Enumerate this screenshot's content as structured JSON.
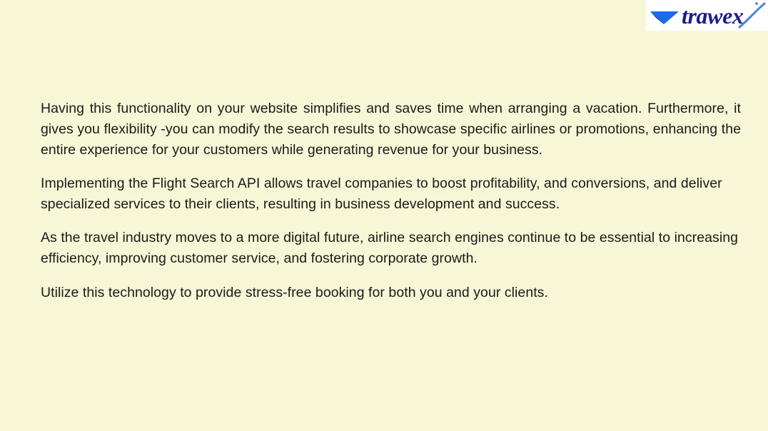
{
  "slide": {
    "background_color": "#f7f7d7",
    "text_color": "#1a1a1a"
  },
  "logo": {
    "brand_name": "trawex",
    "wordmark_color": "#1b1b8f",
    "arrow_color": "#1a6ae8",
    "arrow_shadow_color": "#0c2a6b",
    "swoosh_color": "#3f7fd6",
    "plate_color": "#ffffff"
  },
  "body": {
    "paragraphs": [
      "Having this functionality on your website simplifies and saves time when arranging a vacation. Furthermore, it gives you flexibility -you can modify the search results to showcase specific airlines or promotions, enhancing the entire experience for your customers while generating revenue for your business.",
      "Implementing the Flight Search API allows travel companies to boost profitability, and conversions, and deliver specialized services to their clients, resulting in business development and success.",
      "As the travel industry moves to a more digital future, airline search engines continue to be essential to increasing efficiency, improving customer service, and fostering corporate growth.",
      "Utilize this technology to provide stress-free booking for both you and your clients."
    ]
  }
}
